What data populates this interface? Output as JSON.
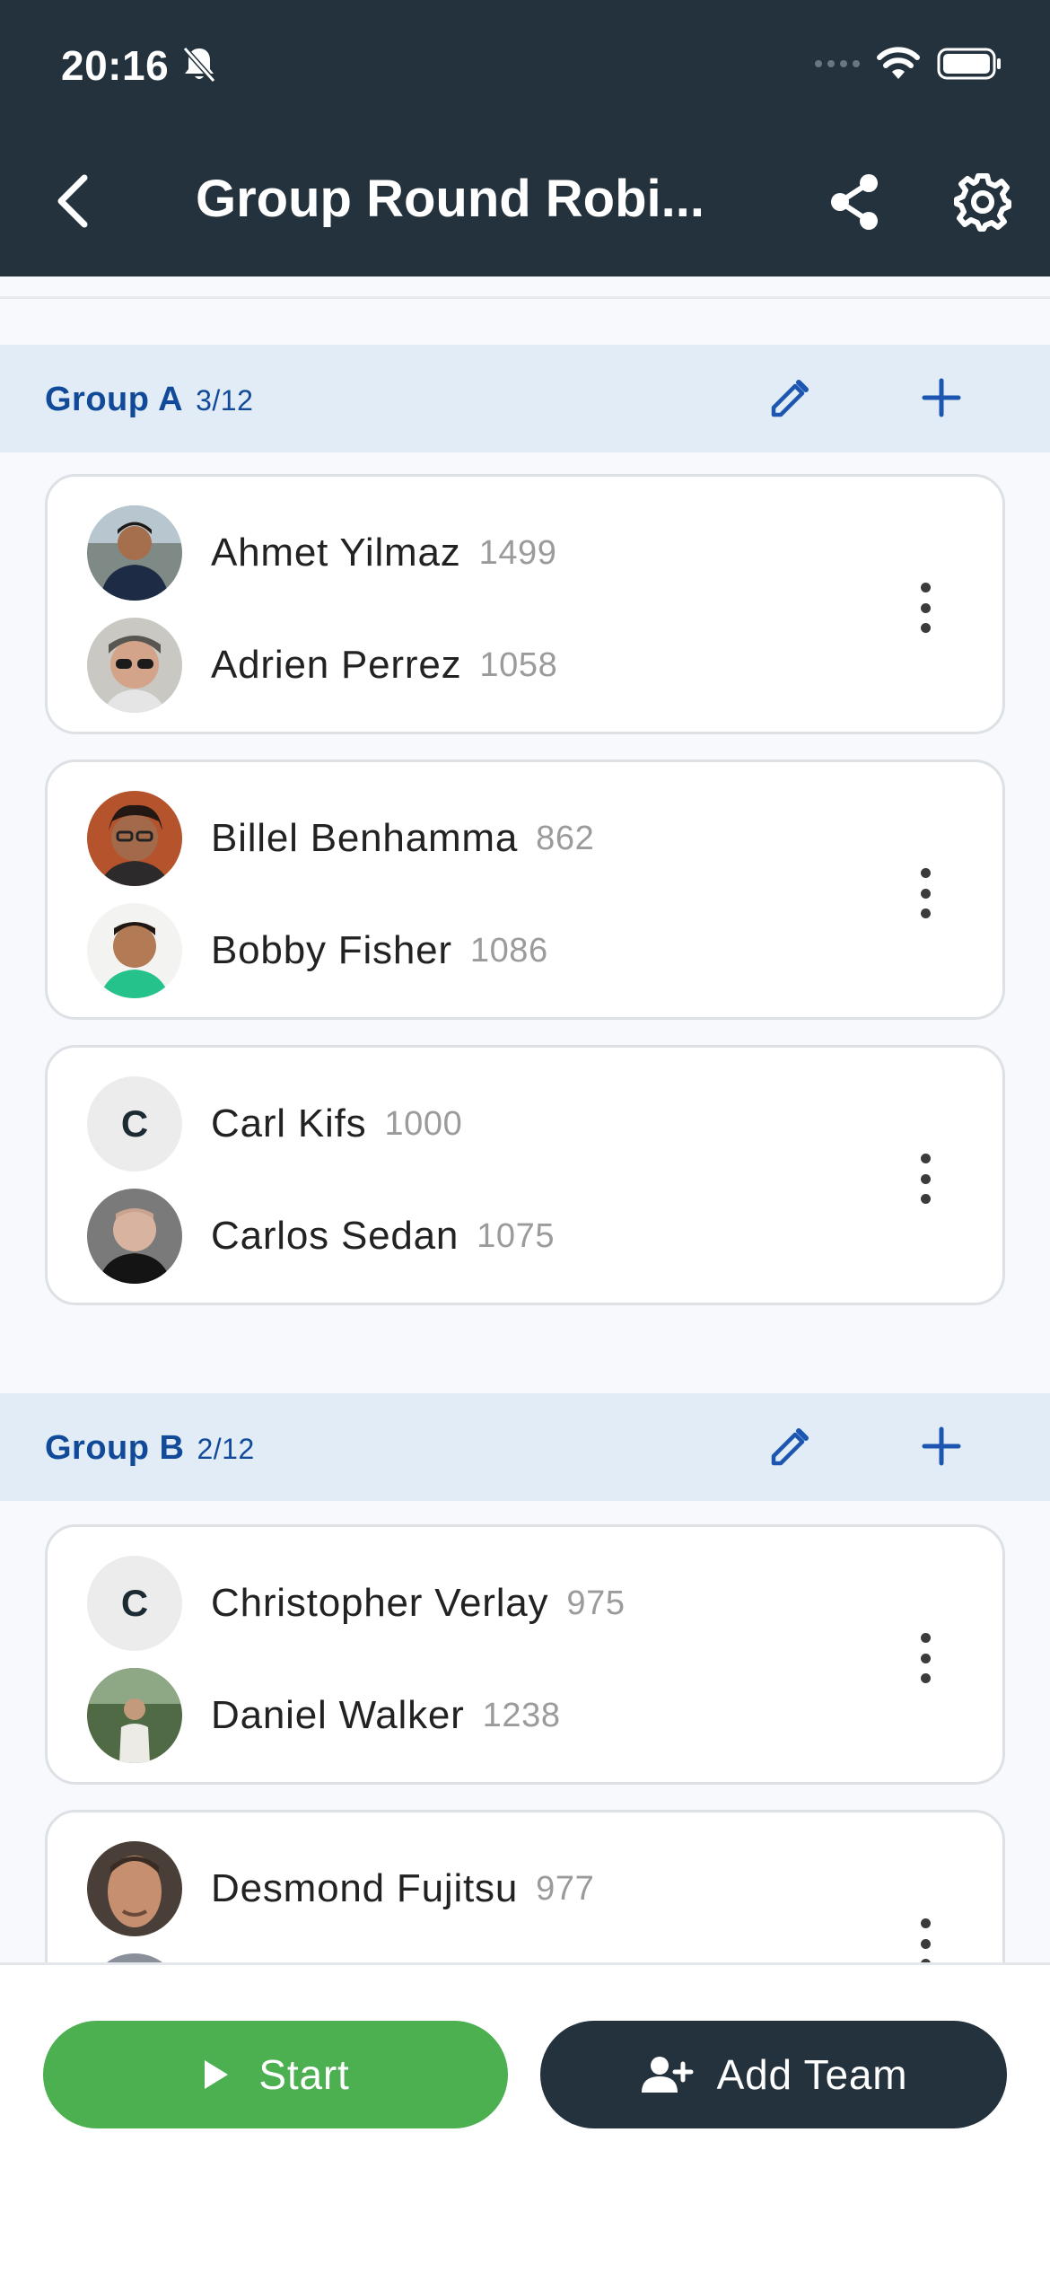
{
  "status_bar": {
    "time": "20:16",
    "icons": [
      "bell-off-icon",
      "signal-icon",
      "wifi-icon",
      "battery-icon"
    ]
  },
  "app_bar": {
    "title": "Group Round Robi...",
    "icons": [
      "back-arrow-icon",
      "share-icon",
      "gear-icon"
    ]
  },
  "groups": [
    {
      "name": "Group A",
      "count": "3/12",
      "teams": [
        {
          "players": [
            {
              "name": "Ahmet Yilmaz",
              "rating": "1499",
              "avatar": "photo"
            },
            {
              "name": "Adrien Perrez",
              "rating": "1058",
              "avatar": "photo"
            }
          ]
        },
        {
          "players": [
            {
              "name": "Billel Benhamma",
              "rating": "862",
              "avatar": "photo"
            },
            {
              "name": "Bobby Fisher",
              "rating": "1086",
              "avatar": "photo"
            }
          ]
        },
        {
          "players": [
            {
              "name": "Carl Kifs",
              "rating": "1000",
              "avatar": "C"
            },
            {
              "name": "Carlos Sedan",
              "rating": "1075",
              "avatar": "photo"
            }
          ]
        }
      ]
    },
    {
      "name": "Group B",
      "count": "2/12",
      "teams": [
        {
          "players": [
            {
              "name": "Christopher Verlay",
              "rating": "975",
              "avatar": "C"
            },
            {
              "name": "Daniel Walker",
              "rating": "1238",
              "avatar": "photo"
            }
          ]
        },
        {
          "players": [
            {
              "name": "Desmond Fujitsu",
              "rating": "977",
              "avatar": "photo"
            }
          ]
        }
      ]
    }
  ],
  "actions": {
    "start_label": "Start",
    "add_team_label": "Add Team"
  },
  "colors": {
    "header": "#24323d",
    "group_band": "#e1ecf7",
    "group_text": "#124a9a",
    "start": "#4caf50",
    "add_team": "#24323d"
  }
}
